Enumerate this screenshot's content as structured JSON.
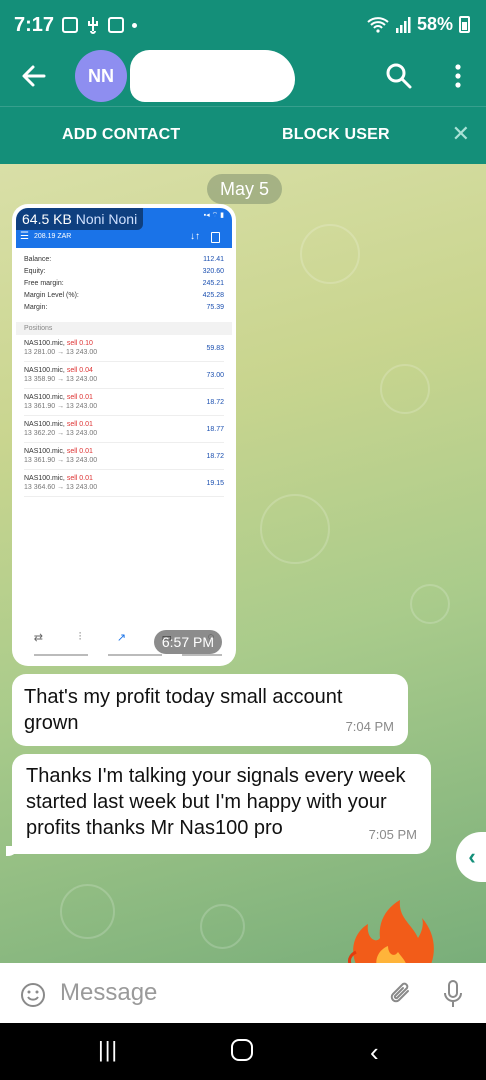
{
  "status_bar": {
    "time": "7:17",
    "battery": "58%"
  },
  "header": {
    "avatar_initials": "NN"
  },
  "action_bar": {
    "add_contact": "ADD CONTACT",
    "block_user": "BLOCK USER"
  },
  "chat": {
    "date": "May 5",
    "image_message": {
      "size": "64.5 KB",
      "sender": "Noni Noni",
      "time": "6:57 PM",
      "screenshot": {
        "balance_header": "208.19 ZAR",
        "rows": [
          {
            "label": "Balance:",
            "value": "112.41"
          },
          {
            "label": "Equity:",
            "value": "320.60"
          },
          {
            "label": "Free margin:",
            "value": "245.21"
          },
          {
            "label": "Margin Level (%):",
            "value": "425.28"
          },
          {
            "label": "Margin:",
            "value": "75.39"
          }
        ],
        "positions_title": "Positions",
        "positions": [
          {
            "symbol": "NAS100.mic,",
            "side": "sell 0.10",
            "prices": "13 281.00 → 13 243.00",
            "profit": "59.83"
          },
          {
            "symbol": "NAS100.mic,",
            "side": "sell 0.04",
            "prices": "13 358.90 → 13 243.00",
            "profit": "73.00"
          },
          {
            "symbol": "NAS100.mic,",
            "side": "sell 0.01",
            "prices": "13 361.90 → 13 243.00",
            "profit": "18.72"
          },
          {
            "symbol": "NAS100.mic,",
            "side": "sell 0.01",
            "prices": "13 362.20 → 13 243.00",
            "profit": "18.77"
          },
          {
            "symbol": "NAS100.mic,",
            "side": "sell 0.01",
            "prices": "13 361.90 → 13 243.00",
            "profit": "18.72"
          },
          {
            "symbol": "NAS100.mic,",
            "side": "sell 0.01",
            "prices": "13 364.60 → 13 243.00",
            "profit": "19.15"
          }
        ]
      }
    },
    "messages": [
      {
        "text": "That's my profit today small account grown",
        "time": "7:04 PM"
      },
      {
        "text": "Thanks I'm talking your signals every week started last week but I'm happy with your profits thanks Mr Nas100 pro",
        "time": "7:05 PM"
      }
    ]
  },
  "input": {
    "placeholder": "Message"
  },
  "colors": {
    "header": "#148f79",
    "avatar": "#8e8ef0"
  }
}
